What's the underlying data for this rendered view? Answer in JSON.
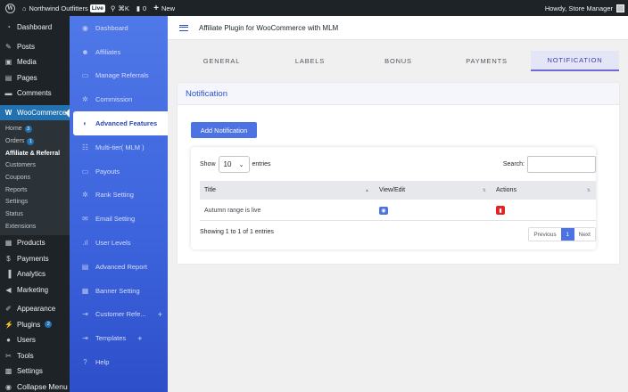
{
  "adminbar": {
    "site_name": "Northwind Outfitters",
    "live_badge": "Live",
    "search_shortcut": "⌘K",
    "comments_count": "0",
    "new_label": "New",
    "greeting": "Howdy, Store Manager"
  },
  "wpmenu": {
    "dashboard": "Dashboard",
    "posts": "Posts",
    "media": "Media",
    "pages": "Pages",
    "comments": "Comments",
    "woocommerce": "WooCommerce",
    "sub": {
      "home": "Home",
      "home_count": "3",
      "orders": "Orders",
      "orders_count": "1",
      "affiliate": "Affiliate & Referral",
      "customers": "Customers",
      "coupons": "Coupons",
      "reports": "Reports",
      "settings": "Settings",
      "status": "Status",
      "extensions": "Extensions"
    },
    "products": "Products",
    "payments": "Payments",
    "analytics": "Analytics",
    "marketing": "Marketing",
    "appearance": "Appearance",
    "plugins": "Plugins",
    "plugins_count": "2",
    "users": "Users",
    "tools": "Tools",
    "settings": "Settings",
    "collapse": "Collapse Menu"
  },
  "psidebar": {
    "items": [
      "Dashboard",
      "Affiliates",
      "Manage Referrals",
      "Commission",
      "Advanced Features",
      "Multi-tier( MLM )",
      "Payouts",
      "Rank Setting",
      "Email Setting",
      "User Levels",
      "Advanced Report",
      "Banner Setting",
      "Customer Refe...",
      "Templates",
      "Help"
    ]
  },
  "topbar": {
    "title": "Affiliate Plugin for WooCommerce with MLM"
  },
  "tabs": [
    "GENERAL",
    "LABELS",
    "BONUS",
    "PAYMENTS",
    "NOTIFICATION"
  ],
  "card": {
    "heading": "Notification",
    "add_button": "Add Notification",
    "show_label": "Show",
    "entries_value": "10",
    "entries_label": "entries",
    "search_label": "Search:",
    "columns": [
      "Title",
      "View/Edit",
      "Actions"
    ],
    "rows": [
      {
        "title": "Autumn range is live"
      }
    ],
    "info": "Showing 1 to 1 of 1 entries",
    "pager": {
      "previous": "Previous",
      "current": "1",
      "next": "Next"
    }
  }
}
